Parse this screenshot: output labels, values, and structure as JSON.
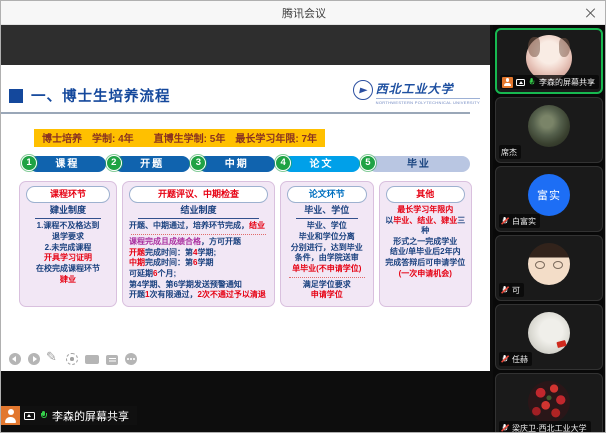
{
  "colors": {
    "n": "#1a417f",
    "r": "#e60012",
    "p": "#aa30a0",
    "b": "#0070c0",
    "info_bg": "#ffc000",
    "info_text": "#8a3420",
    "flow_dark_blue": "#1063ae",
    "flow_cyan": "#00a0e9",
    "flow_light": "#b9c6e2",
    "speaking_green": "#17b850"
  },
  "window": {
    "title": "腾讯会议",
    "controls": [
      {
        "id": "minimize",
        "name": "minimize-button",
        "icon": "minimize-icon"
      },
      {
        "id": "maximize",
        "name": "maximize-button",
        "icon": "maximize-icon"
      },
      {
        "id": "close",
        "name": "close-button",
        "icon": "close-icon"
      }
    ]
  },
  "slide": {
    "title": "一、博士生培养流程",
    "logo": {
      "name": "西北工业大学",
      "subtext": "NORTHWESTERN POLYTECHNICAL UNIVERSITY"
    },
    "info_bar": "博士培养　学制: 4年　　直博生学制: 5年　最长学习年限: 7年",
    "flow": [
      {
        "num": "1",
        "label": "课程",
        "bg": "#1063ae",
        "fg": "#ffffff"
      },
      {
        "num": "2",
        "label": "开题",
        "bg": "#1063ae",
        "fg": "#ffffff"
      },
      {
        "num": "3",
        "label": "中期",
        "bg": "#1063ae",
        "fg": "#ffffff"
      },
      {
        "num": "4",
        "label": "论文",
        "bg": "#00a0e9",
        "fg": "#ffffff"
      },
      {
        "num": "5",
        "label": "毕业",
        "bg": "#b9c6e2",
        "fg": "#17427e"
      }
    ],
    "boxes": [
      {
        "id": "course",
        "pill": "课程环节",
        "pill_color": "r",
        "header": "肄业制度",
        "align": "center",
        "lines": [
          [
            {
              "t": "1.课程不及格达到",
              "c": "n"
            }
          ],
          [
            {
              "t": "退学要求",
              "c": "n"
            }
          ],
          [
            {
              "t": "2.未完成课程",
              "c": "n"
            }
          ],
          [
            {
              "t": "开具学习证明",
              "c": "r"
            }
          ],
          [
            {
              "t": "在校完成课程环节",
              "c": "n"
            }
          ],
          [
            {
              "t": "肄业",
              "c": "r"
            }
          ]
        ]
      },
      {
        "id": "proposal-midterm",
        "pill": "开题评议、中期检查",
        "pill_color": "r",
        "header": "结业制度",
        "align": "left",
        "lines": [
          [
            {
              "t": "开题、中期通过，培养环节完成，",
              "c": "n"
            },
            {
              "t": "结业",
              "c": "r"
            }
          ],
          "sep",
          [
            {
              "t": "课程完成且成绩合格",
              "c": "p"
            },
            {
              "t": "，方可开题",
              "c": "n"
            }
          ],
          [
            {
              "t": "开题",
              "c": "r"
            },
            {
              "t": "完成时间：第",
              "c": "n"
            },
            {
              "t": "4",
              "c": "r"
            },
            {
              "t": "学期;",
              "c": "n"
            }
          ],
          [
            {
              "t": "中期",
              "c": "r"
            },
            {
              "t": "完成时间：第",
              "c": "n"
            },
            {
              "t": "6",
              "c": "r"
            },
            {
              "t": "学期",
              "c": "n"
            }
          ],
          [
            {
              "t": "可延期",
              "c": "n"
            },
            {
              "t": "6",
              "c": "r"
            },
            {
              "t": "个月;",
              "c": "n"
            }
          ],
          [
            {
              "t": "第4学期、第6学期发送预警通知",
              "c": "n"
            }
          ],
          [
            {
              "t": "开题",
              "c": "n"
            },
            {
              "t": "1",
              "c": "r"
            },
            {
              "t": "次有限通过，",
              "c": "n"
            },
            {
              "t": "2次不通过予以清退",
              "c": "r"
            }
          ]
        ]
      },
      {
        "id": "thesis",
        "pill": "论文环节",
        "pill_color": "b",
        "header": "毕业、学位",
        "align": "center",
        "lines": [
          [
            {
              "t": "毕业、学位",
              "c": "n"
            }
          ],
          [
            {
              "t": "毕业和学位分离",
              "c": "n"
            }
          ],
          [
            {
              "t": "分别进行，达到毕业",
              "c": "n"
            }
          ],
          [
            {
              "t": "条件，由学院送审",
              "c": "n"
            }
          ],
          [
            {
              "t": "单毕业(不申请学位)",
              "c": "r"
            }
          ],
          "sep",
          [
            {
              "t": "满足学位要求",
              "c": "n"
            }
          ],
          [
            {
              "t": "申请学位",
              "c": "r"
            }
          ]
        ]
      },
      {
        "id": "other",
        "pill": "其他",
        "pill_color": "r",
        "header": null,
        "align": "center",
        "lines": [
          [
            {
              "t": "最长学习年限内",
              "c": "r"
            }
          ],
          [
            {
              "t": "以",
              "c": "n"
            },
            {
              "t": "毕业、结业、肄业",
              "c": "r"
            },
            {
              "t": "三种",
              "c": "n"
            }
          ],
          [
            {
              "t": "形式之一完成学业",
              "c": "n"
            }
          ],
          [
            {
              "t": "结业/单毕业后2年内",
              "c": "n"
            }
          ],
          [
            {
              "t": "完成答辩后可申请学位",
              "c": "n"
            }
          ],
          [
            {
              "t": "(一次申请机会)",
              "c": "r"
            }
          ]
        ]
      }
    ],
    "toolbar": [
      {
        "id": "prev",
        "name": "previous-slide-icon"
      },
      {
        "id": "next",
        "name": "next-slide-icon"
      },
      {
        "id": "pen",
        "name": "pen-icon"
      },
      {
        "id": "laser",
        "name": "laser-pointer-icon"
      },
      {
        "id": "camera",
        "name": "camera-icon"
      },
      {
        "id": "comment",
        "name": "comment-icon"
      },
      {
        "id": "more",
        "name": "more-icon"
      }
    ]
  },
  "share_overlay": {
    "label": "李森的屏幕共享"
  },
  "sidebar": {
    "participants": [
      {
        "name": "李森的屏幕共享",
        "speaking": true,
        "avatar": {
          "type": "photo-girl"
        },
        "icons": [
          "member-badge",
          "screen-share",
          "mic-on"
        ]
      },
      {
        "name": "席杰",
        "avatar": {
          "type": "photo-dark"
        },
        "icons": []
      },
      {
        "name": "白富实",
        "avatar": {
          "type": "initials",
          "text": "富实",
          "bg": "#1d6ef5"
        },
        "icons": [
          "mic-muted"
        ]
      },
      {
        "name": "可",
        "avatar": {
          "type": "cartoon"
        },
        "icons": [
          "mic-muted"
        ]
      },
      {
        "name": "任赫",
        "avatar": {
          "type": "photo-light"
        },
        "icons": [
          "mic-muted"
        ]
      },
      {
        "name": "梁庆卫·西北工业大学",
        "avatar": {
          "type": "photo-flowers"
        },
        "icons": [
          "mic-muted"
        ]
      }
    ]
  }
}
